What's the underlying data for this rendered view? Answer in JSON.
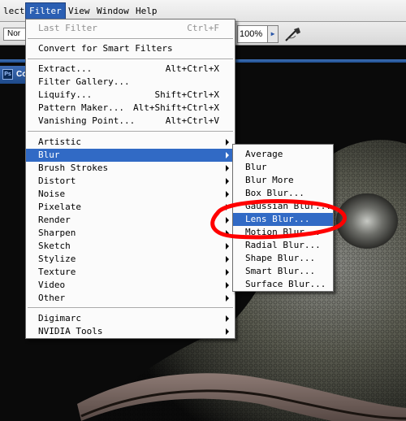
{
  "menubar": {
    "items": [
      "lect",
      "Filter",
      "View",
      "Window",
      "Help"
    ],
    "active_index": 1
  },
  "options": {
    "mode_value": "Nor",
    "zoom_value": "100%",
    "zoom_arrow_icon": "triangle-right-icon",
    "airbrush_icon": "airbrush-icon"
  },
  "document": {
    "title": "Co",
    "app_icon_text": "Ps"
  },
  "filter_menu": {
    "last_filter": {
      "label": "Last Filter",
      "shortcut": "Ctrl+F"
    },
    "convert_smart": "Convert for Smart Filters",
    "tools": [
      {
        "label": "Extract...",
        "shortcut": "Alt+Ctrl+X"
      },
      {
        "label": "Filter Gallery...",
        "shortcut": ""
      },
      {
        "label": "Liquify...",
        "shortcut": "Shift+Ctrl+X"
      },
      {
        "label": "Pattern Maker...",
        "shortcut": "Alt+Shift+Ctrl+X"
      },
      {
        "label": "Vanishing Point...",
        "shortcut": "Alt+Ctrl+V"
      }
    ],
    "groups": [
      "Artistic",
      "Blur",
      "Brush Strokes",
      "Distort",
      "Noise",
      "Pixelate",
      "Render",
      "Sharpen",
      "Sketch",
      "Stylize",
      "Texture",
      "Video",
      "Other"
    ],
    "plugins": [
      "Digimarc",
      "NVIDIA Tools"
    ],
    "highlight_color": "#316ac5"
  },
  "blur_menu": {
    "items": [
      "Average",
      "Blur",
      "Blur More",
      "Box Blur...",
      "Gaussian Blur...",
      "Lens Blur...",
      "Motion Blur...",
      "Radial Blur...",
      "Shape Blur...",
      "Smart Blur...",
      "Surface Blur..."
    ],
    "highlight_index": 5
  },
  "annotation": {
    "color": "#ff0000",
    "shape": "ellipse"
  }
}
